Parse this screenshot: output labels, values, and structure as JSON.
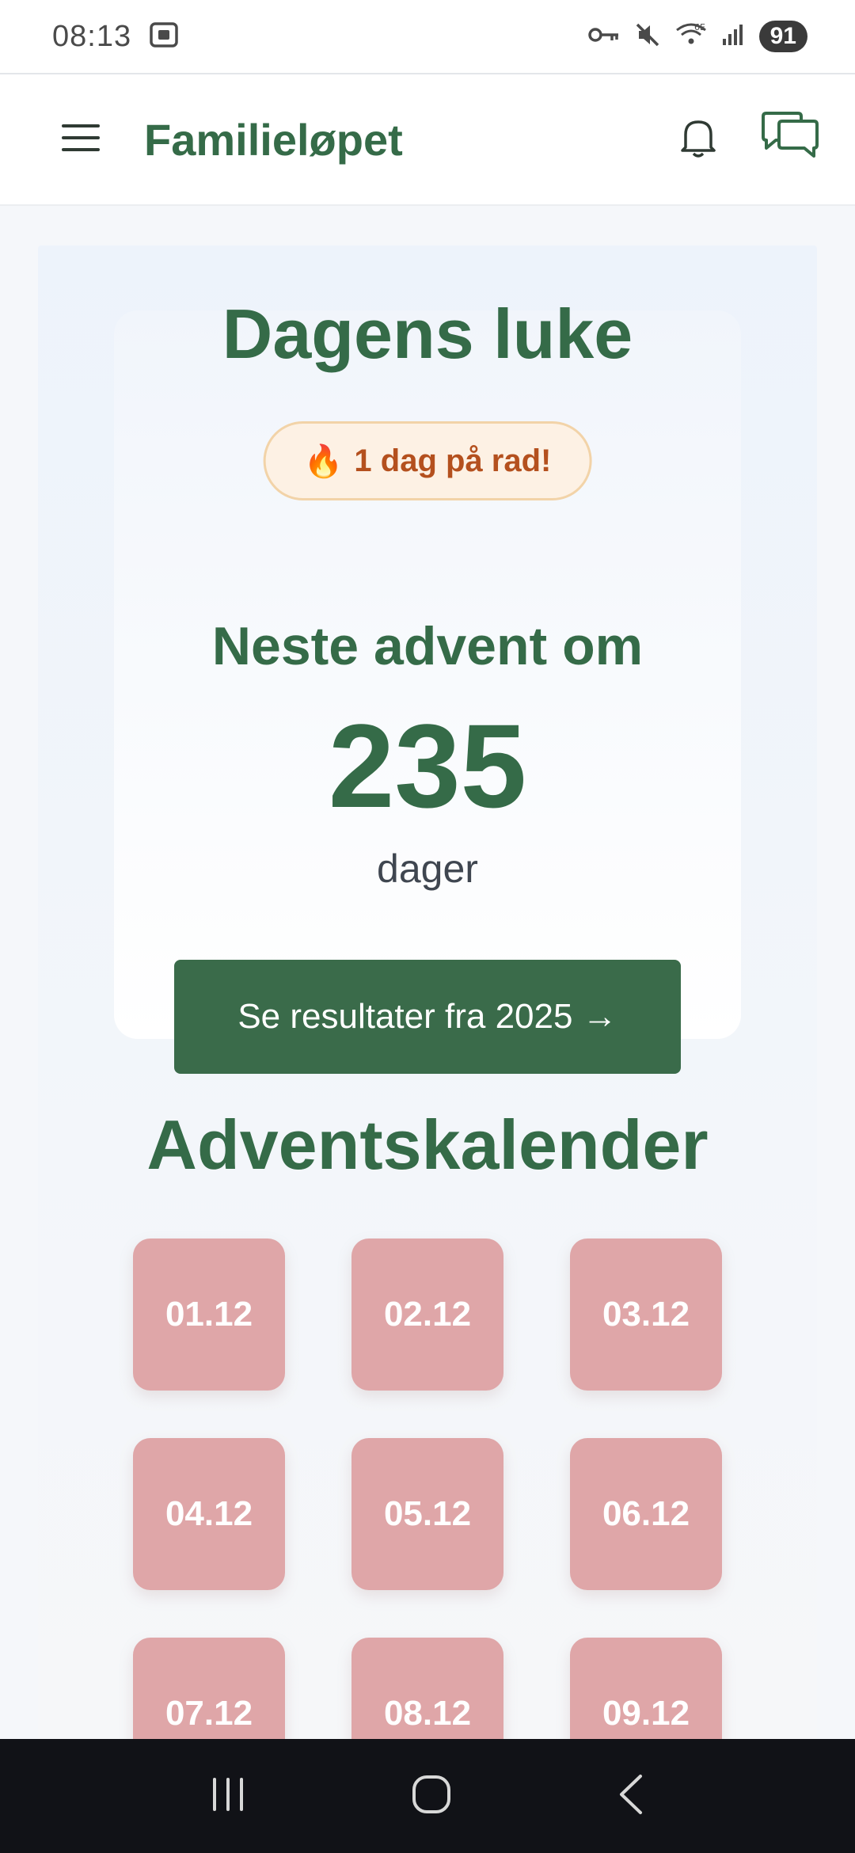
{
  "status_bar": {
    "time": "08:13",
    "battery": "91",
    "icons": [
      "screenshot-icon",
      "key-icon",
      "mute-icon",
      "wifi-6e-icon",
      "signal-icon"
    ]
  },
  "app_bar": {
    "title": "Familieløpet",
    "icons": [
      "menu-icon",
      "bell-icon",
      "chat-icon"
    ]
  },
  "today_card": {
    "title": "Dagens luke",
    "streak_emoji": "🔥",
    "streak_label": "1 dag på rad!",
    "next_advent_label": "Neste advent om",
    "days_count": "235",
    "days_unit": "dager",
    "results_button": "Se resultater fra 2025 →"
  },
  "calendar": {
    "title": "Adventskalender",
    "doors": [
      {
        "label": "01.12"
      },
      {
        "label": "02.12"
      },
      {
        "label": "03.12"
      },
      {
        "label": "04.12"
      },
      {
        "label": "05.12"
      },
      {
        "label": "06.12"
      },
      {
        "label": "07.12"
      },
      {
        "label": "08.12"
      },
      {
        "label": "09.12"
      }
    ]
  },
  "colors": {
    "brand_green": "#356b48",
    "button_green": "#3a6b4a",
    "door_pink": "#dfa6a8",
    "streak_text": "#b4501e",
    "streak_bg": "#fdf1e4"
  },
  "nav_bar": {
    "icons": [
      "recent-apps-icon",
      "home-icon",
      "back-icon"
    ]
  }
}
